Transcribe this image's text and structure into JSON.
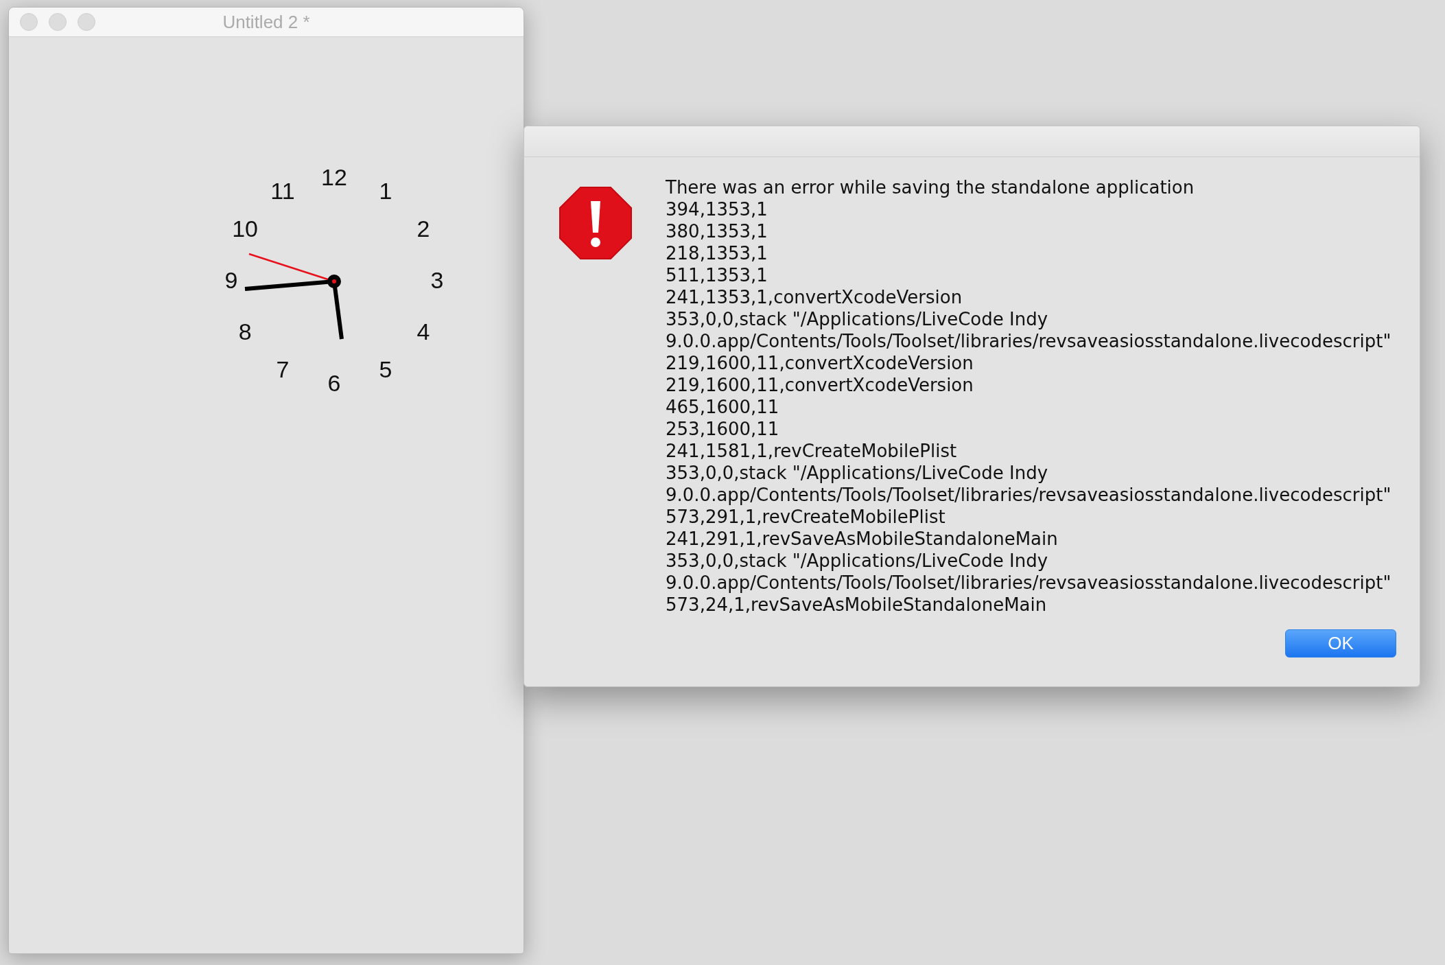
{
  "window": {
    "title": "Untitled 2 *"
  },
  "clock": {
    "numerals": [
      "12",
      "1",
      "2",
      "3",
      "4",
      "5",
      "6",
      "7",
      "8",
      "9",
      "10",
      "11"
    ]
  },
  "dialog": {
    "lines": [
      "There was an error while saving the standalone application",
      "394,1353,1",
      "380,1353,1",
      "218,1353,1",
      "511,1353,1",
      "241,1353,1,convertXcodeVersion",
      "353,0,0,stack \"/Applications/LiveCode Indy",
      "9.0.0.app/Contents/Tools/Toolset/libraries/revsaveasiosstandalone.livecodescript\"",
      "219,1600,11,convertXcodeVersion",
      "219,1600,11,convertXcodeVersion",
      "465,1600,11",
      "253,1600,11",
      "241,1581,1,revCreateMobilePlist",
      "353,0,0,stack \"/Applications/LiveCode Indy",
      "9.0.0.app/Contents/Tools/Toolset/libraries/revsaveasiosstandalone.livecodescript\"",
      "573,291,1,revCreateMobilePlist",
      "241,291,1,revSaveAsMobileStandaloneMain",
      "353,0,0,stack \"/Applications/LiveCode Indy",
      "9.0.0.app/Contents/Tools/Toolset/libraries/revsaveasiosstandalone.livecodescript\"",
      "573,24,1,revSaveAsMobileStandaloneMain"
    ],
    "button": "OK"
  }
}
